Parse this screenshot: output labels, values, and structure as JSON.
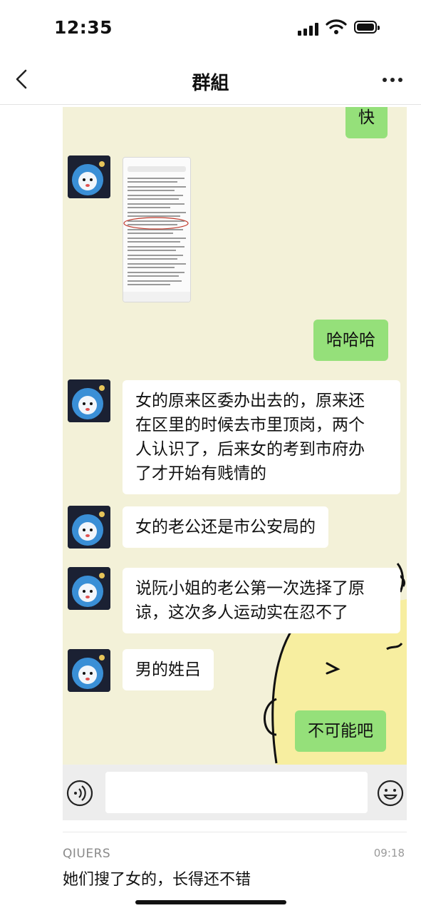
{
  "status_bar": {
    "time": "12:35"
  },
  "nav": {
    "title": "群組",
    "back_icon": "chevron-left-icon",
    "more_icon": "ellipsis-icon"
  },
  "chat": {
    "messages": [
      {
        "side": "out",
        "type": "text",
        "text": "快"
      },
      {
        "side": "in",
        "type": "image",
        "text": ""
      },
      {
        "side": "out",
        "type": "text",
        "text": "哈哈哈"
      },
      {
        "side": "in",
        "type": "text",
        "lines": [
          "女的原来区委办出去的，原来还",
          "在区里的时候去市里顶岗，两个",
          "人认识了，后来女的考到市府办",
          "了才开始有贱情的"
        ]
      },
      {
        "side": "in",
        "type": "text",
        "text": "女的老公还是市公安局的"
      },
      {
        "side": "in",
        "type": "text",
        "lines": [
          "说阮小姐的老公第一次选择了原",
          "谅，这次多人运动实在忍不了"
        ]
      },
      {
        "side": "in",
        "type": "text",
        "text": "男的姓吕"
      },
      {
        "side": "out",
        "type": "text",
        "text": "不可能吧"
      }
    ],
    "input_bar": {
      "voice_icon": "voice-icon",
      "emoji_icon": "emoji-icon"
    }
  },
  "comment": {
    "user": "QIUERS",
    "time": "09:18",
    "text": "她们搜了女的，长得还不错"
  },
  "colors": {
    "outgoing_bubble": "#95e07a",
    "incoming_bubble": "#ffffff",
    "chat_background": "#f3f1d8"
  }
}
